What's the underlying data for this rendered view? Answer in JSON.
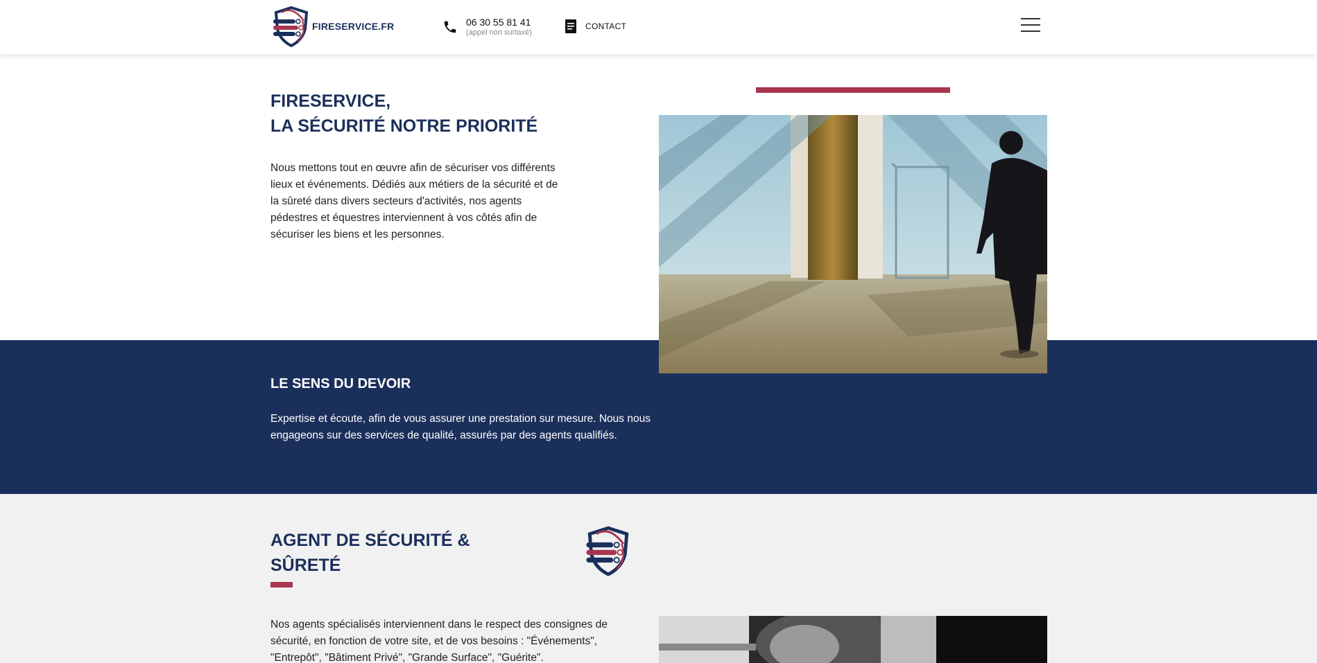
{
  "header": {
    "logo_text": "FIRESERVICE.FR",
    "phone_number": "06 30 55 81 41",
    "phone_note": "(appel non surtaxé)",
    "contact_label": "CONTACT"
  },
  "hero": {
    "title_line1": "FIRESERVICE,",
    "title_line2": "LA SÉCURITÉ NOTRE PRIORITÉ",
    "text": "Nous mettons tout en œuvre afin de sécuriser vos différents lieux et événements. Dédiés aux métiers de la sécurité et de la sûreté dans divers secteurs d'activités, nos agents pédestres et équestres interviennent à vos côtés afin de sécuriser les biens et les personnes."
  },
  "duty": {
    "title": "LE SENS DU DEVOIR",
    "text": "Expertise et écoute, afin de vous assurer une prestation sur mesure. Nous nous engageons sur des services de qualité, assurés par des agents qualifiés."
  },
  "agent": {
    "title_line1": "AGENT DE SÉCURITÉ &",
    "title_line2": "SÛRETÉ",
    "text": "Nos agents spécialisés interviennent dans le respect des consignes de sécurité, en fonction de votre site, et de vos besoins : \"Événements\", \"Entrepôt\", \"Bâtiment Privé\", \"Grande Surface\", \"Guérite\"."
  },
  "colors": {
    "navy": "#1b2f5b",
    "accent": "#a8354e",
    "grey_bg": "#f1f1f2"
  },
  "icons": [
    "shield-logo-icon",
    "phone-icon",
    "document-icon",
    "hamburger-menu-icon"
  ]
}
